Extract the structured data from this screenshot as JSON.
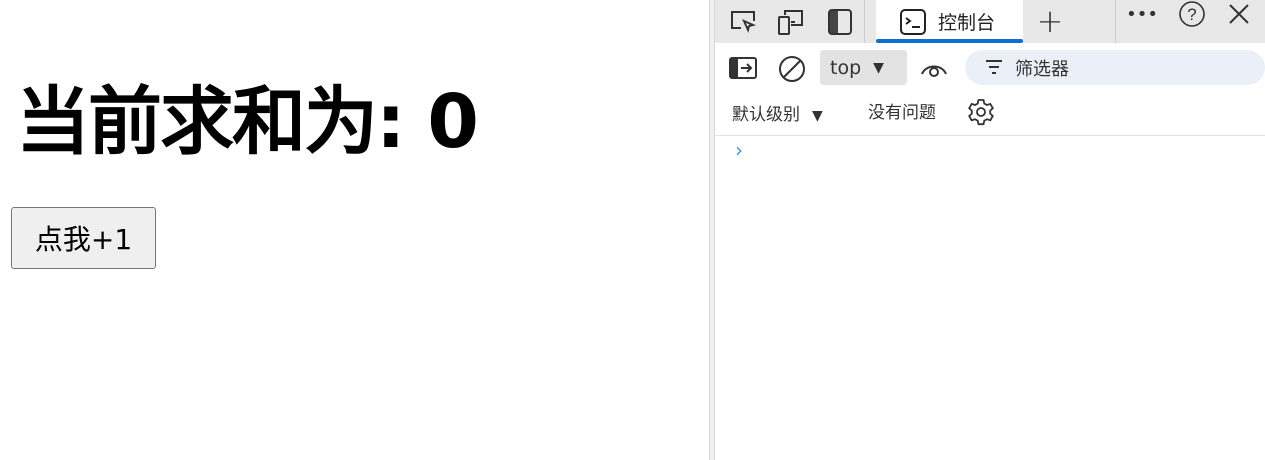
{
  "page": {
    "heading": "当前求和为: 0",
    "button_label": "点我+1"
  },
  "devtools": {
    "tabs": [
      {
        "label": "控制台",
        "active": true
      }
    ],
    "context": "top",
    "filter_placeholder": "筛选器",
    "levels": "默认级别",
    "issues": "没有问题",
    "prompt": "›",
    "accent": "#0a6fd1"
  }
}
